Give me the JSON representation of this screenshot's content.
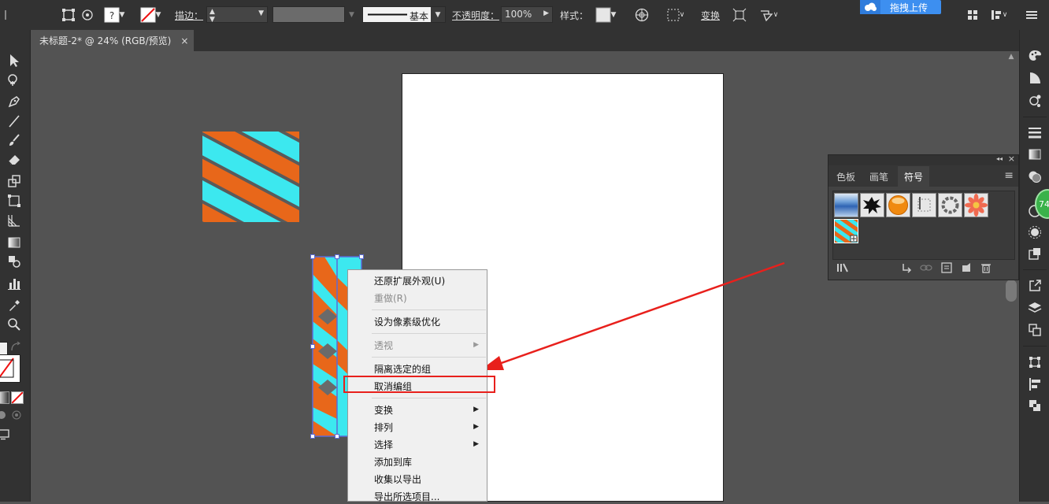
{
  "control_bar": {
    "stroke_label": "描边：",
    "stroke_style_label": "基本",
    "opacity_label": "不透明度：",
    "opacity_value": "100%",
    "style_label": "样式：",
    "transform_label": "变换",
    "upload_label": "拖拽上传"
  },
  "document_tab": {
    "title": "未标题-2* @ 24% (RGB/预览)",
    "close": "×"
  },
  "symbols_panel": {
    "tabs": [
      "色板",
      "画笔",
      "符号"
    ],
    "active_tab": "符号",
    "collapse": "◂◂",
    "close": "×",
    "menu": "≡"
  },
  "context_menu": {
    "items": [
      {
        "label": "还原扩展外观(U)",
        "enabled": true,
        "submenu": false
      },
      {
        "label": "重做(R)",
        "enabled": false,
        "submenu": false
      },
      {
        "label": "设为像素级优化",
        "enabled": true,
        "submenu": false
      },
      {
        "label": "透视",
        "enabled": false,
        "submenu": true
      },
      {
        "label": "隔离选定的组",
        "enabled": true,
        "submenu": false
      },
      {
        "label": "取消编组",
        "enabled": true,
        "submenu": false,
        "highlighted": true
      },
      {
        "label": "变换",
        "enabled": true,
        "submenu": true
      },
      {
        "label": "排列",
        "enabled": true,
        "submenu": true
      },
      {
        "label": "选择",
        "enabled": true,
        "submenu": true
      },
      {
        "label": "添加到库",
        "enabled": true,
        "submenu": false
      },
      {
        "label": "收集以导出",
        "enabled": true,
        "submenu": false
      },
      {
        "label": "导出所选项目...",
        "enabled": true,
        "submenu": false
      }
    ]
  },
  "badge": {
    "text": "74"
  },
  "colors": {
    "cyan": "#3ce8ef",
    "orange": "#e8671a",
    "annotation_red": "#e8201c",
    "upload_blue": "#3d8ff0"
  }
}
